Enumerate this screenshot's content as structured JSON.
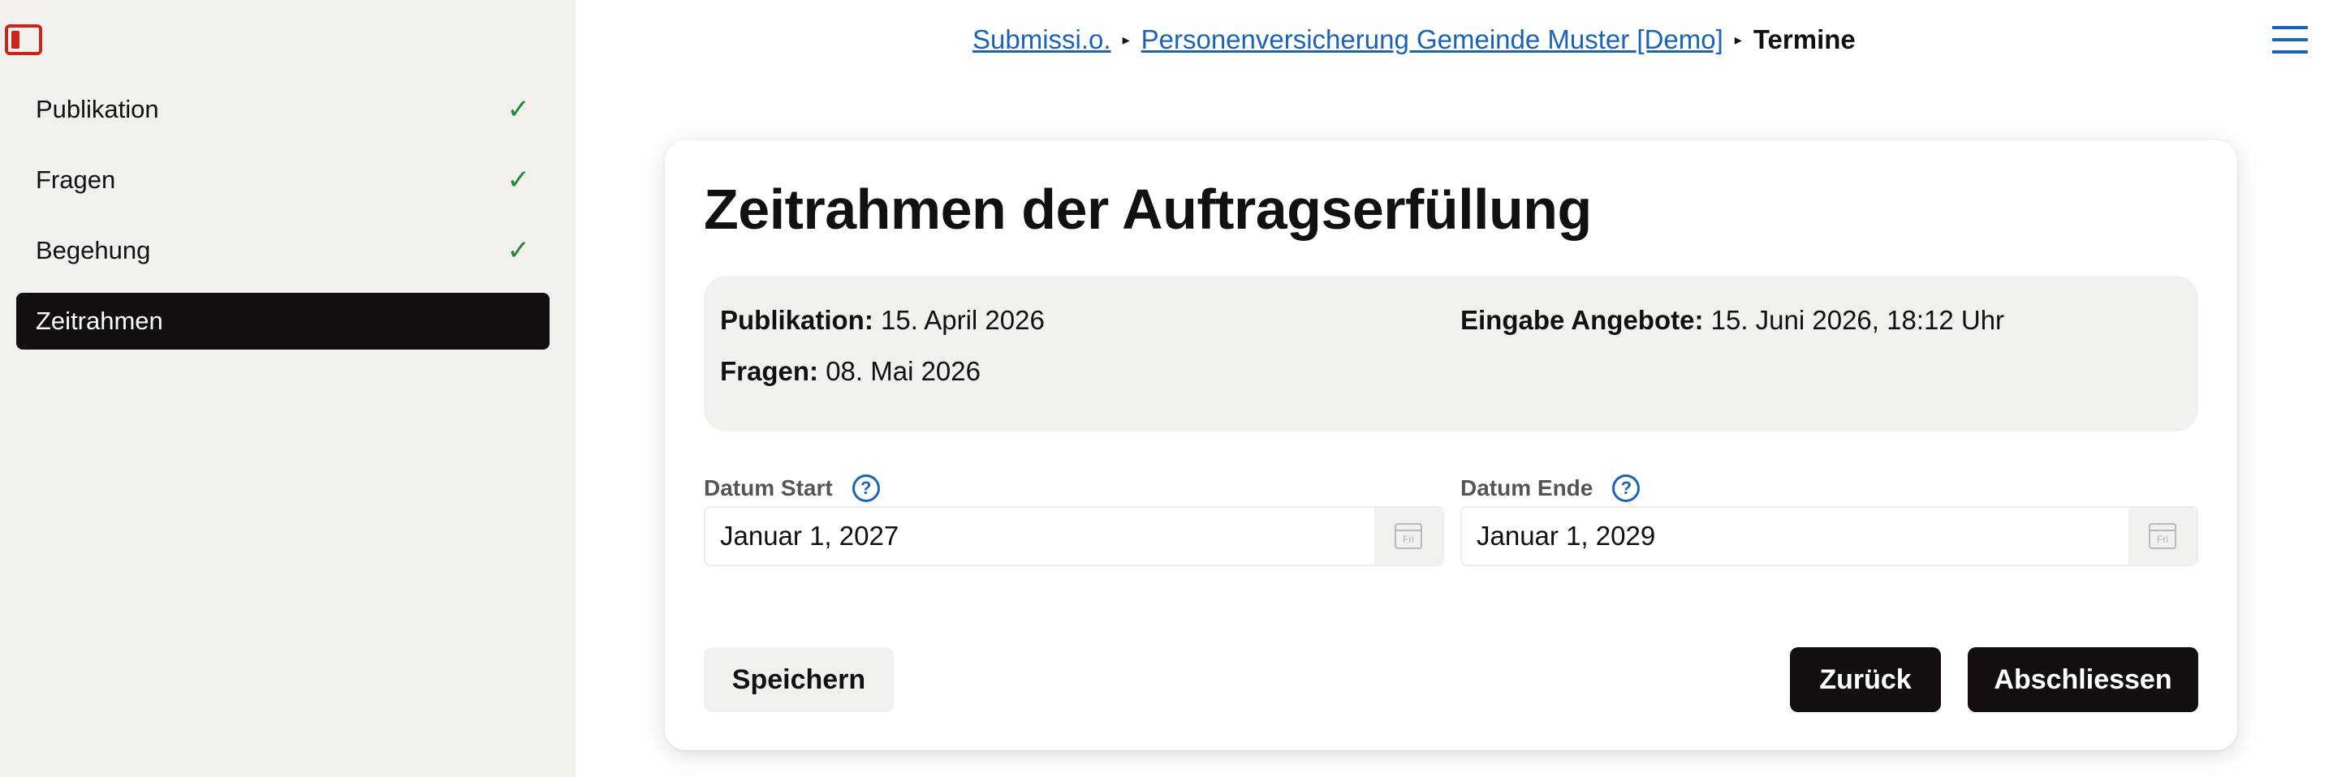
{
  "sidebar": {
    "items": [
      {
        "label": "Publikation",
        "status": "✓"
      },
      {
        "label": "Fragen",
        "status": "✓"
      },
      {
        "label": "Begehung",
        "status": "✓"
      },
      {
        "label": "Zeitrahmen",
        "status": ""
      }
    ]
  },
  "breadcrumb": {
    "link1": "Submissi.o.",
    "link2": "Personenversicherung Gemeinde Muster [Demo]",
    "separator": "▸",
    "current": "Termine"
  },
  "colors": {
    "accent": "#1a63b8",
    "dark": "#130f10",
    "panel": "#f1f0ec",
    "success": "#1f8a3a",
    "toggle": "#c8261c"
  },
  "card": {
    "title": "Zeitrahmen der Auftragserfüllung",
    "summary": {
      "publikation_label": "Publikation:",
      "publikation_value": "15. April 2026",
      "fragen_label": "Fragen:",
      "fragen_value": "08. Mai 2026",
      "eingabe_label": "Eingabe Angebote:",
      "eingabe_value": "15. Juni 2026, 18:12 Uhr"
    },
    "start": {
      "label": "Datum Start",
      "value": "Januar 1, 2027",
      "help": "?",
      "cal_text": "Fri"
    },
    "end": {
      "label": "Datum Ende",
      "value": "Januar 1, 2029",
      "help": "?",
      "cal_text": "Fri"
    }
  },
  "actions": {
    "save": "Speichern",
    "back": "Zurück",
    "finish": "Abschliessen"
  }
}
